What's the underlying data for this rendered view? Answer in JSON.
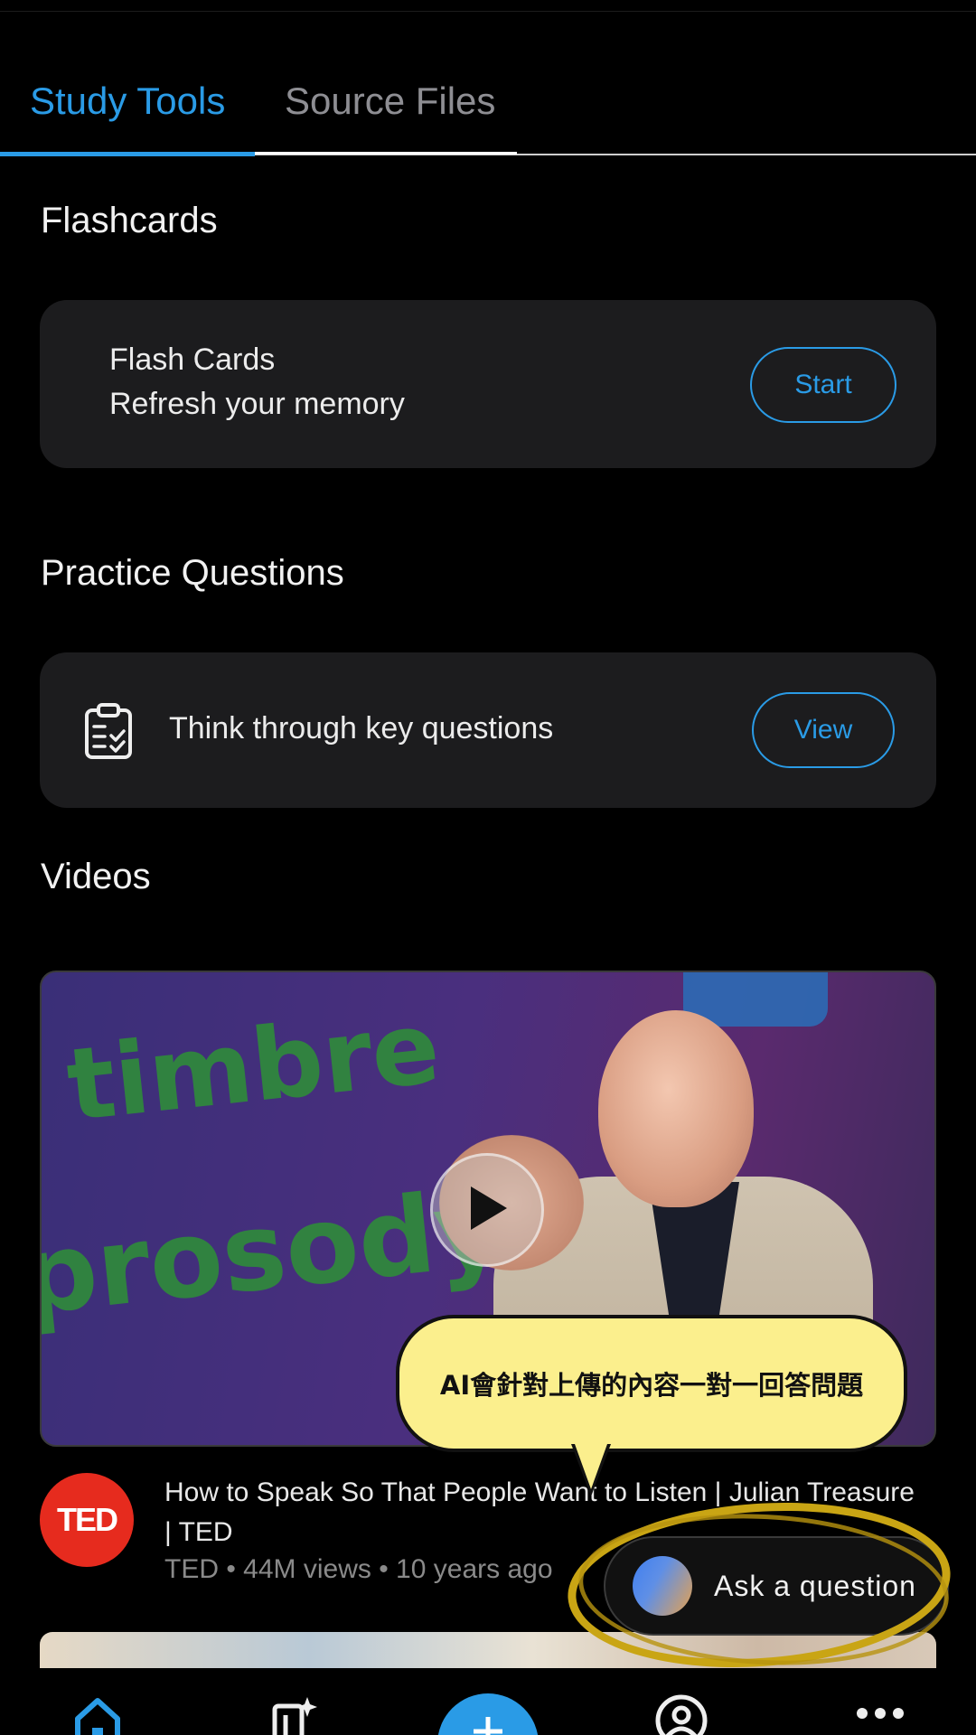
{
  "tabs": [
    {
      "label": "Study Tools",
      "active": true
    },
    {
      "label": "Source Files",
      "active": false
    }
  ],
  "flashcards": {
    "section_title": "Flashcards",
    "card_title": "Flash Cards",
    "card_subtitle": "Refresh your memory",
    "button_label": "Start"
  },
  "practice": {
    "section_title": "Practice Questions",
    "card_text": "Think through key questions",
    "icon": "clipboard-check-icon",
    "button_label": "View"
  },
  "videos": {
    "section_title": "Videos",
    "thumbnail_words": [
      "timbre",
      "prosody"
    ],
    "channel_logo": "TED",
    "title": "How to Speak So That People Want to Listen | Julian Treasure | TED",
    "meta": "TED • 44M views • 10 years ago"
  },
  "annotation": {
    "bubble_text": "AI會針對上傳的內容一對一回答問題"
  },
  "ask_button": {
    "label": "Ask a question"
  },
  "bottom_nav": {
    "items": [
      "home-icon",
      "flashcard-sparkle-icon",
      "add-icon",
      "profile-icon",
      "more-icon"
    ]
  },
  "colors": {
    "accent": "#2a9be6",
    "card_bg": "#1c1c1e",
    "highlight_ring": "#c9a514",
    "bubble_bg": "#fbef8d",
    "ted_red": "#e62b1e"
  }
}
